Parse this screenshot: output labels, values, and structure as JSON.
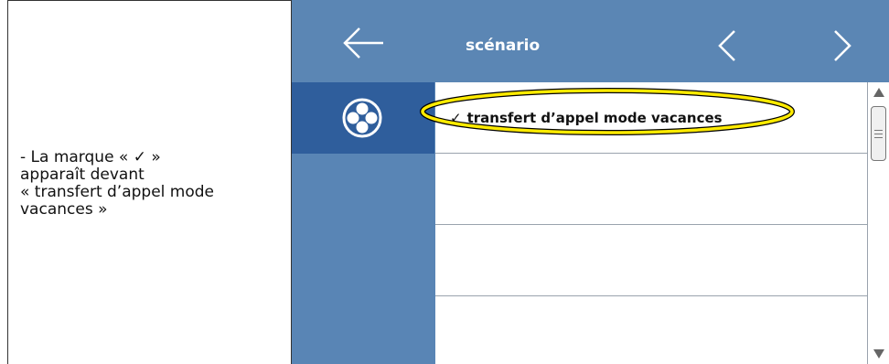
{
  "caption": {
    "text": "- La marque « ✓ »\napparaît devant\n« transfert d’appel mode\nvacances »"
  },
  "header": {
    "title": "scénario",
    "back_icon": "arrow-left-icon",
    "prev_icon": "chevron-left-icon",
    "next_icon": "chevron-right-icon"
  },
  "sidebar": {
    "active_tab_icon": "scenario-circle-icon"
  },
  "list": {
    "items": [
      {
        "check": "✓",
        "label": "transfert d’appel mode vacances",
        "selected": true,
        "highlighted": true
      },
      {
        "check": "",
        "label": "",
        "selected": false
      },
      {
        "check": "",
        "label": "",
        "selected": false
      },
      {
        "check": "",
        "label": "",
        "selected": false
      }
    ]
  },
  "colors": {
    "header_bg": "#5b86b4",
    "active_tab_bg": "#2f5e9c",
    "highlight_ring": "#ffeb00"
  }
}
